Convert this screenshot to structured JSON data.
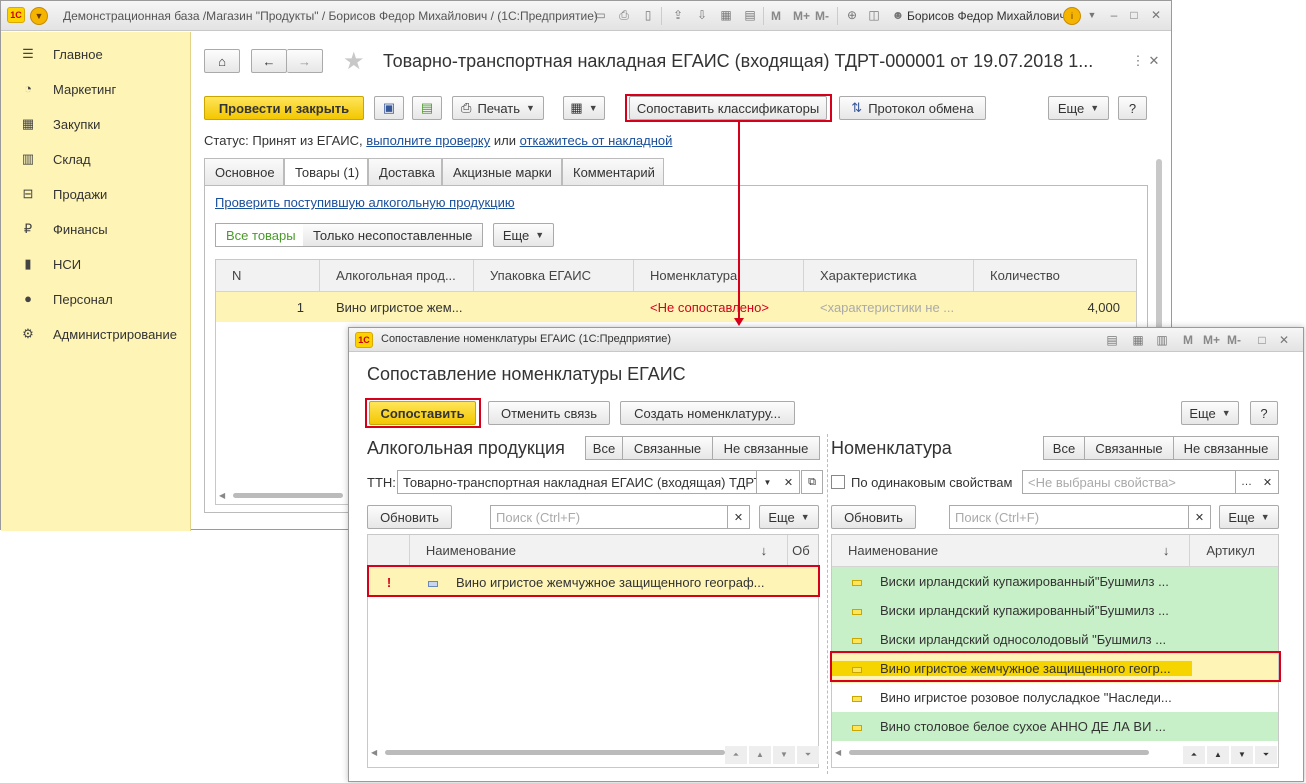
{
  "main_window": {
    "title": "Демонстрационная база /Магазин \"Продукты\" / Борисов Федор Михайлович / (1С:Предприятие)",
    "user": "Борисов Федор Михайлович",
    "logo": "1С",
    "m_buttons": [
      "M",
      "M+",
      "M-"
    ]
  },
  "sidebar": {
    "items": [
      {
        "label": "Главное",
        "icon": "menu-icon"
      },
      {
        "label": "Маркетинг",
        "icon": "pie-chart-icon"
      },
      {
        "label": "Закупки",
        "icon": "cart-icon"
      },
      {
        "label": "Склад",
        "icon": "warehouse-icon"
      },
      {
        "label": "Продажи",
        "icon": "basket-icon"
      },
      {
        "label": "Финансы",
        "icon": "ruble-icon"
      },
      {
        "label": "НСИ",
        "icon": "book-icon"
      },
      {
        "label": "Персонал",
        "icon": "person-icon"
      },
      {
        "label": "Администрирование",
        "icon": "gear-icon"
      }
    ]
  },
  "document": {
    "title": "Товарно-транспортная накладная ЕГАИС (входящая) ТДРТ-000001 от 19.07.2018 1...",
    "btn_post": "Провести и закрыть",
    "btn_print": "Печать",
    "btn_match": "Сопоставить классификаторы",
    "btn_protocol": "Протокол обмена",
    "btn_more": "Еще",
    "btn_help": "?",
    "status_prefix": "Статус:",
    "status_text": "Принят из ЕГАИС,",
    "status_link1": "выполните проверку",
    "status_or": "или",
    "status_link2": "откажитесь от накладной",
    "tabs": [
      "Основное",
      "Товары (1)",
      "Доставка",
      "Акцизные марки",
      "Комментарий"
    ],
    "check_link": "Проверить поступившую алкогольную продукцию",
    "filter_all": "Все товары",
    "filter_unmatched": "Только несопоставленные",
    "columns": [
      "N",
      "Алкогольная прод...",
      "Упаковка ЕГАИС",
      "Номенклатура",
      "Характеристика",
      "Количество"
    ],
    "rows": [
      {
        "n": "1",
        "product": "Вино игристое жем...",
        "pack": "",
        "nomenclature": "<Не сопоставлено>",
        "characteristic": "<характеристики не ...",
        "qty": "4,000"
      }
    ]
  },
  "dialog": {
    "window_title": "Сопоставление номенклатуры ЕГАИС  (1С:Предприятие)",
    "title": "Сопоставление номенклатуры ЕГАИС",
    "btn_match": "Сопоставить",
    "btn_unlink": "Отменить связь",
    "btn_create": "Создать номенклатуру...",
    "btn_more": "Еще",
    "btn_help": "?",
    "left": {
      "heading": "Алкогольная продукция",
      "filters": [
        "Все",
        "Связанные",
        "Не связанные"
      ],
      "ttn_label": "ТТН:",
      "ttn_value": "Товарно-транспортная накладная ЕГАИС (входящая) ТДРТ",
      "refresh": "Обновить",
      "search_placeholder": "Поиск (Ctrl+F)",
      "more": "Еще",
      "col_name": "Наименование",
      "col_extra": "Об",
      "rows": [
        {
          "mark": "!",
          "name": "Вино игристое жемчужное защищенного географ..."
        }
      ]
    },
    "right": {
      "heading": "Номенклатура",
      "filters": [
        "Все",
        "Связанные",
        "Не связанные"
      ],
      "same_props": "По одинаковым свойствам",
      "props_placeholder": "<Не выбраны свойства>",
      "refresh": "Обновить",
      "search_placeholder": "Поиск (Ctrl+F)",
      "more": "Еще",
      "col_name": "Наименование",
      "col_article": "Артикул",
      "rows": [
        {
          "name": "Виски ирландский купажированный\"Бушмилз ...",
          "state": "linked"
        },
        {
          "name": "Виски ирландский купажированный\"Бушмилз ...",
          "state": "linked"
        },
        {
          "name": "Виски ирландский односолодовый \"Бушмилз ...",
          "state": "linked"
        },
        {
          "name": "Вино игристое жемчужное защищенного геогр...",
          "state": "selected"
        },
        {
          "name": "Вино игристое розовое полусладкое \"Наследи...",
          "state": "normal"
        },
        {
          "name": "Вино столовое белое сухое АННО ДЕ ЛА ВИ ...",
          "state": "linked"
        }
      ]
    }
  },
  "colors": {
    "accent_yellow": "#f3c700",
    "highlight_red": "#d7001b",
    "link_blue": "#1a4f9a",
    "linked_green": "#c8f0c8"
  }
}
